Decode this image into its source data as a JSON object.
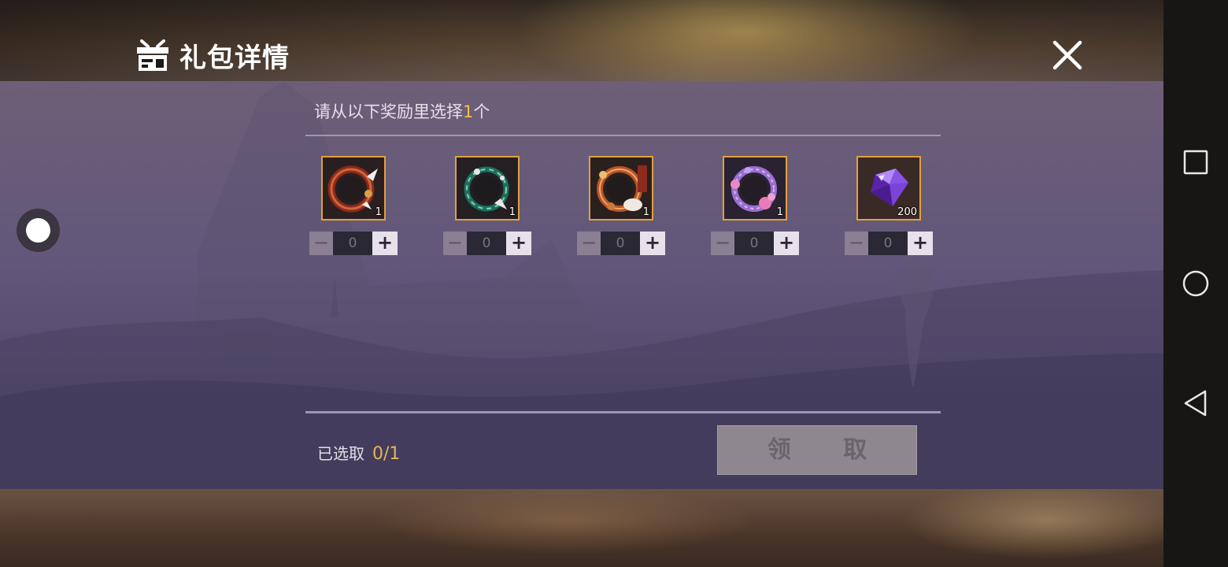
{
  "header": {
    "title": "礼包详情",
    "title_icon": "gift-box-icon",
    "close_icon": "close-icon"
  },
  "panel": {
    "prompt_prefix": "请从以下奖励里选择",
    "prompt_count": "1",
    "prompt_suffix": "个",
    "rewards": [
      {
        "icon": "red-avatar-frame-icon",
        "amount": "1",
        "stepper_value": "0",
        "minus": "−",
        "plus": "+"
      },
      {
        "icon": "green-avatar-frame-icon",
        "amount": "1",
        "stepper_value": "0",
        "minus": "−",
        "plus": "+"
      },
      {
        "icon": "orange-avatar-frame-icon",
        "amount": "1",
        "stepper_value": "0",
        "minus": "−",
        "plus": "+"
      },
      {
        "icon": "purple-flower-avatar-frame-icon",
        "amount": "1",
        "stepper_value": "0",
        "minus": "−",
        "plus": "+"
      },
      {
        "icon": "purple-diamond-icon",
        "amount": "200",
        "stepper_value": "0",
        "minus": "−",
        "plus": "+"
      }
    ],
    "selected_label": "已选取",
    "selected_count": "0/1",
    "claim_label": "领 取"
  },
  "system_nav": {
    "recents_icon": "square-recents-icon",
    "home_icon": "circle-home-icon",
    "back_icon": "triangle-back-icon"
  },
  "colors": {
    "highlight": "#f0c24e",
    "frame_border": "#e0a040",
    "panel_bg": "#62577a"
  }
}
